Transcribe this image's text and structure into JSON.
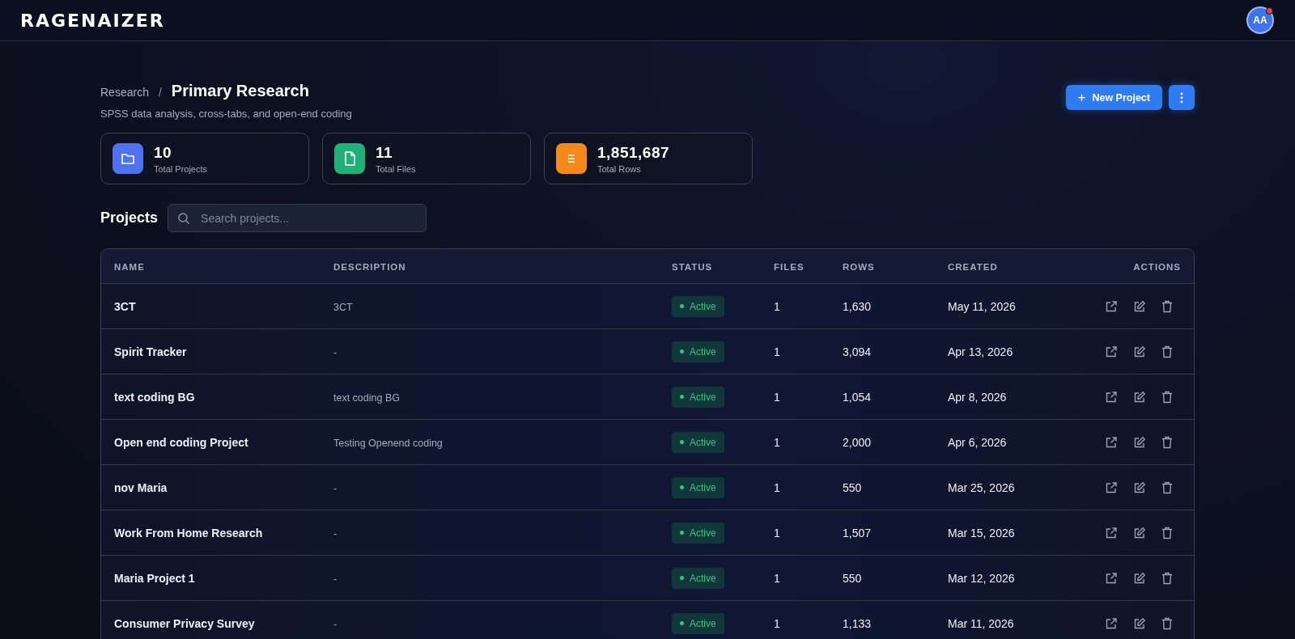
{
  "header": {
    "logo": "RAGENAIZER",
    "avatar": {
      "initials": "AA",
      "notification": true
    }
  },
  "breadcrumb": {
    "parent": "Research",
    "separator": "/",
    "current": "Primary Research"
  },
  "subtitle": "SPSS data analysis, cross-tabs, and open-end coding",
  "actions": {
    "new_button": "New Project",
    "plus": "+"
  },
  "stats": [
    {
      "kind": "folder",
      "color": "#4f73f0",
      "value": "10",
      "label": "Total Projects"
    },
    {
      "kind": "file",
      "color": "#22b07a",
      "value": "11",
      "label": "Total Files"
    },
    {
      "kind": "list",
      "color": "#f58a1c",
      "value": "1,851,687",
      "label": "Total Rows"
    }
  ],
  "projects": {
    "title": "Projects",
    "search": {
      "placeholder": "Search projects..."
    }
  },
  "table": {
    "columns": [
      "NAME",
      "DESCRIPTION",
      "STATUS",
      "FILES",
      "ROWS",
      "CREATED",
      "ACTIONS"
    ],
    "rows": [
      {
        "name": "3CT",
        "description": "3CT",
        "status": "Active",
        "files": "1",
        "rows": "1,630",
        "created": "May 11, 2026"
      },
      {
        "name": "Spirit Tracker",
        "description": "-",
        "status": "Active",
        "files": "1",
        "rows": "3,094",
        "created": "Apr 13, 2026"
      },
      {
        "name": "text coding BG",
        "description": "text coding BG",
        "status": "Active",
        "files": "1",
        "rows": "1,054",
        "created": "Apr 8, 2026"
      },
      {
        "name": "Open end coding Project",
        "description": "Testing Openend coding",
        "status": "Active",
        "files": "1",
        "rows": "2,000",
        "created": "Apr 6, 2026"
      },
      {
        "name": "nov Maria",
        "description": "-",
        "status": "Active",
        "files": "1",
        "rows": "550",
        "created": "Mar 25, 2026"
      },
      {
        "name": "Work From Home Research",
        "description": "-",
        "status": "Active",
        "files": "1",
        "rows": "1,507",
        "created": "Mar 15, 2026"
      },
      {
        "name": "Maria Project 1",
        "description": "-",
        "status": "Active",
        "files": "1",
        "rows": "550",
        "created": "Mar 12, 2026"
      },
      {
        "name": "Consumer Privacy Survey",
        "description": "-",
        "status": "Active",
        "files": "1",
        "rows": "1,133",
        "created": "Mar 11, 2026"
      }
    ]
  }
}
